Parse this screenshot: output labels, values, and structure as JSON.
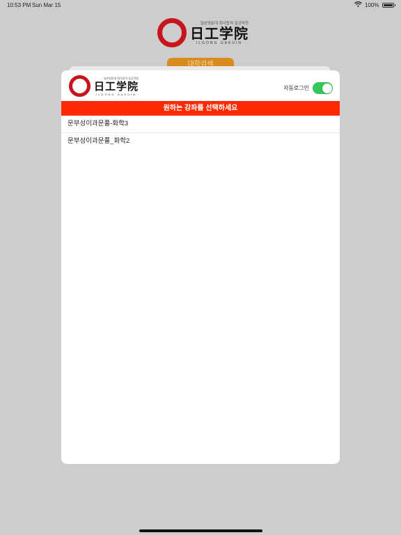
{
  "status_bar": {
    "time": "10:53 PM",
    "date": "Sun Mar 15",
    "battery": "100%",
    "wifi_icon": "wifi-icon",
    "battery_icon": "battery-icon"
  },
  "logo": {
    "tagline": "일본명문대 최다합격·일공학원",
    "name": "日工学院",
    "roman": "ILGONG GAKUIN",
    "brand_color": "#c8141c"
  },
  "background": {
    "button_label": "대학검색",
    "button_color": "#d98b1e"
  },
  "modal": {
    "auto_login_label": "자동로그인",
    "auto_login_on": true,
    "banner": "원하는 강좌를 선택하세요",
    "banner_color": "#ff2a00",
    "courses": [
      {
        "label": "문부성이과문풀-화학3"
      },
      {
        "label": "문부성이과문풀_화학2"
      }
    ]
  }
}
